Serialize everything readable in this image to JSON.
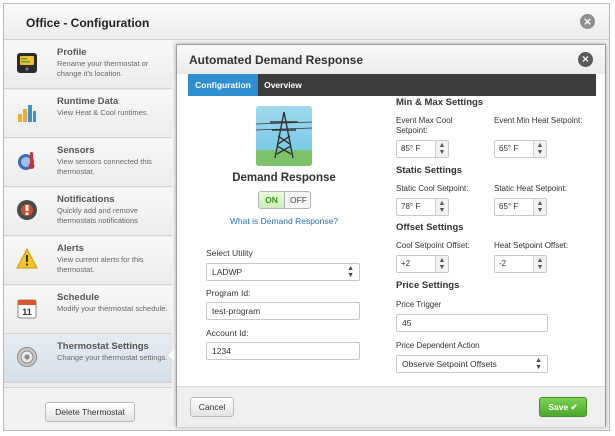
{
  "window": {
    "title": "Office - Configuration",
    "close_icon": "close-circle-icon"
  },
  "sidebar": {
    "items": [
      {
        "title": "Profile",
        "desc": "Rename your thermostat or change it's location.",
        "icon": "thermostat-icon"
      },
      {
        "title": "Runtime Data",
        "desc": "View Heat & Cool runtimes.",
        "icon": "bar-chart-icon"
      },
      {
        "title": "Sensors",
        "desc": "View sensors connected this thermostat.",
        "icon": "thermometer-icon"
      },
      {
        "title": "Notifications",
        "desc": "Quickly add and remove thermostats notifications",
        "icon": "notification-icon"
      },
      {
        "title": "Alerts",
        "desc": "View current alerts for this thermostat.",
        "icon": "warning-icon"
      },
      {
        "title": "Schedule",
        "desc": "Modify your thermostat schedule.",
        "icon": "calendar-icon",
        "calendar_day": "11"
      },
      {
        "title": "Thermostat Settings",
        "desc": "Change your thermostat settings.",
        "icon": "settings-icon"
      }
    ],
    "delete_label": "Delete Thermostat"
  },
  "panel": {
    "title": "Automated Demand Response",
    "tabs": [
      "Configuration",
      "Overview"
    ],
    "active_tab": "Configuration",
    "hero": {
      "icon": "power-tower-icon",
      "title": "Demand Response",
      "toggle_on": "ON",
      "toggle_off": "OFF",
      "toggle_state": "ON",
      "link": "What is Demand Response?"
    },
    "form": {
      "utility_label": "Select Utility",
      "utility_value": "LADWP",
      "program_label": "Program Id:",
      "program_value": "test-program",
      "account_label": "Account Id:",
      "account_value": "1234"
    },
    "minmax": {
      "heading": "Min & Max Settings",
      "max_cool_label": "Event Max Cool Setpoint:",
      "max_cool_value": "85° F",
      "min_heat_label": "Event Min Heat Setpoint:",
      "min_heat_value": "65° F"
    },
    "static": {
      "heading": "Static Settings",
      "cool_label": "Static Cool Setpoint:",
      "cool_value": "78° F",
      "heat_label": "Static Heat Setpoint:",
      "heat_value": "65° F"
    },
    "offset": {
      "heading": "Offset Settings",
      "cool_label": "Cool Setpoint Offset:",
      "cool_value": "+2",
      "heat_label": "Heat Setpoint Offset:",
      "heat_value": "-2"
    },
    "price": {
      "heading": "Price Settings",
      "trigger_label": "Price Trigger",
      "trigger_value": "45",
      "action_label": "Price Dependent Action",
      "action_value": "Observe Setpoint Offsets"
    },
    "footer": {
      "cancel_label": "Cancel",
      "save_label": "Save ✔"
    }
  },
  "colors": {
    "tab_active": "#2f8fd0",
    "tab_bar": "#3c3c3c",
    "save_button": "#4aa72c",
    "link": "#2b6fb5",
    "sidebar_active": "#d6dfe9"
  }
}
